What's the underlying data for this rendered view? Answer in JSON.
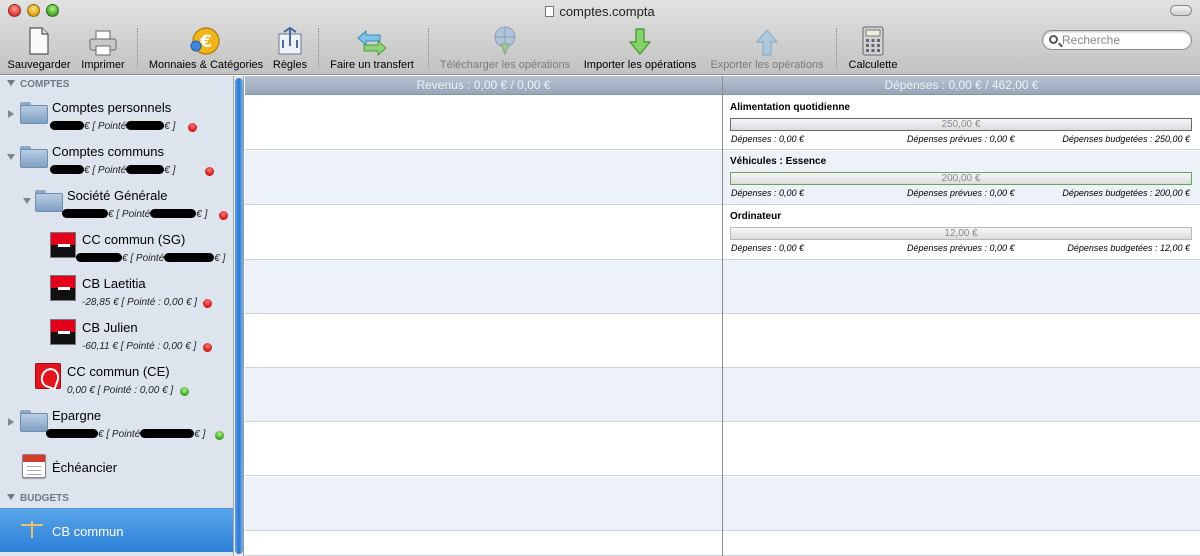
{
  "window": {
    "title": "comptes.compta"
  },
  "toolbar": {
    "save": "Sauvegarder",
    "print": "Imprimer",
    "currencies": "Monnaies & Catégories",
    "rules": "Règles",
    "transfer": "Faire un transfert",
    "download": "Télécharger les opérations",
    "import": "Importer les opérations",
    "export": "Exporter les opérations",
    "calculator": "Calculette"
  },
  "search": {
    "placeholder": "Recherche",
    "value": ""
  },
  "sidebar": {
    "accounts_header": "COMPTES",
    "budgets_header": "BUDGETS",
    "schedule": "Échéancier",
    "budget_item": "CB commun",
    "groups": {
      "perso": {
        "name": "Comptes personnels",
        "cur": "€ [ Pointé",
        "end": "€ ]"
      },
      "communs": {
        "name": "Comptes communs",
        "cur": "€ [ Pointé",
        "end": "€ ]"
      },
      "sg": {
        "name": "Société Générale",
        "cur": "€ [ Pointé",
        "end": "€ ]"
      },
      "epargne": {
        "name": "Epargne",
        "cur": "€ [ Pointé",
        "end": "€ ]"
      }
    },
    "accounts": {
      "cc_sg": {
        "name": "CC commun (SG)",
        "cur": "€ [ Pointé",
        "end": "€ ]"
      },
      "cb_laetitia": {
        "name": "CB Laetitia",
        "summary": "-28,85 € [ Pointé : 0,00 € ]"
      },
      "cb_julien": {
        "name": "CB Julien",
        "summary": "-60,11 € [ Pointé : 0,00 € ]"
      },
      "cc_ce": {
        "name": "CC commun (CE)",
        "summary": "0,00 € [ Pointé : 0,00 € ]"
      }
    }
  },
  "panes": {
    "revenus": "Revenus : 0,00 € / 0,00 €",
    "depenses": "Dépenses : 0,00 € / 462,00 €"
  },
  "budget_categories": [
    {
      "name": "Alimentation quotidienne",
      "bar": "250,00 €",
      "depenses": "Dépenses : 0,00 €",
      "prevues": "Dépenses prévues : 0,00 €",
      "budgetees": "Dépenses budgetées : 250,00 €"
    },
    {
      "name": "Véhicules : Essence",
      "bar": "200,00 €",
      "depenses": "Dépenses : 0,00 €",
      "prevues": "Dépenses prévues : 0,00 €",
      "budgetees": "Dépenses budgetées : 200,00 €"
    },
    {
      "name": "Ordinateur",
      "bar": "12,00 €",
      "depenses": "Dépenses : 0,00 €",
      "prevues": "Dépenses prévues : 0,00 €",
      "budgetees": "Dépenses budgetées : 12,00 €"
    }
  ],
  "colors": {
    "selection": "#2a7fd6",
    "sidebar_bg": "#dde4ed",
    "status_red": "#d31818",
    "status_green": "#3ea51f"
  }
}
